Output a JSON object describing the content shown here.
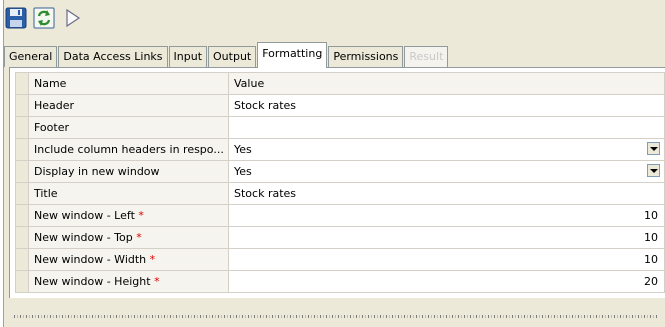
{
  "toolbar": {
    "buttons": [
      {
        "icon": "save-icon"
      },
      {
        "icon": "refresh-icon"
      },
      {
        "icon": "run-icon"
      }
    ]
  },
  "tabs": [
    {
      "label": "General",
      "state": "normal"
    },
    {
      "label": "Data Access Links",
      "state": "normal"
    },
    {
      "label": "Input",
      "state": "normal"
    },
    {
      "label": "Output",
      "state": "normal"
    },
    {
      "label": "Formatting",
      "state": "active"
    },
    {
      "label": "Permissions",
      "state": "normal"
    },
    {
      "label": "Result",
      "state": "disabled"
    }
  ],
  "grid": {
    "columns": [
      "Name",
      "Value"
    ],
    "rows": [
      {
        "name": "Header",
        "value": "Stock rates"
      },
      {
        "name": "Footer",
        "value": ""
      },
      {
        "name": "Include column headers in respo...",
        "value": "Yes"
      },
      {
        "name": "Display in new window",
        "value": "Yes"
      },
      {
        "name": "Title",
        "value": "Stock rates"
      },
      {
        "name": "New window - Left",
        "required_mark": "*",
        "value": "10"
      },
      {
        "name": "New window - Top",
        "required_mark": "*",
        "value": "10"
      },
      {
        "name": "New window - Width",
        "required_mark": "*",
        "value": "10"
      },
      {
        "name": "New window - Height",
        "required_mark": "*",
        "value": "20"
      }
    ]
  },
  "colors": {
    "required": "#e00000",
    "background": "#ece9d8"
  }
}
